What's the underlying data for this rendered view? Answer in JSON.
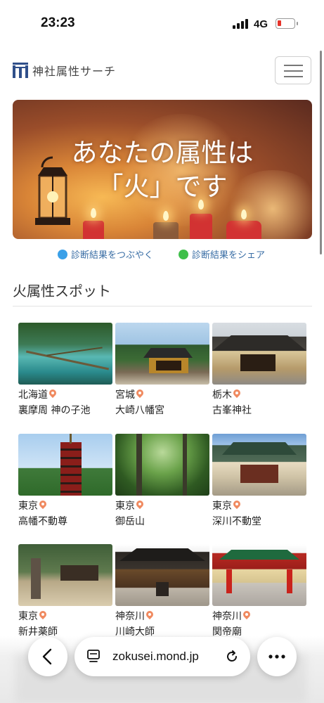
{
  "status_bar": {
    "time": "23:23",
    "network": "4G"
  },
  "header": {
    "site_title": "神社属性サーチ"
  },
  "hero": {
    "line1": "あなたの属性は",
    "line2": "「火」です"
  },
  "share": {
    "twitter_label": "診断結果をつぶやく",
    "line_label": "診断結果をシェア"
  },
  "section": {
    "title": "火属性スポット"
  },
  "spots": [
    {
      "pref": "北海道",
      "name": "裏摩周 神の子池"
    },
    {
      "pref": "宮城",
      "name": "大崎八幡宮"
    },
    {
      "pref": "栃木",
      "name": "古峯神社"
    },
    {
      "pref": "東京",
      "name": "高幡不動尊"
    },
    {
      "pref": "東京",
      "name": "御岳山"
    },
    {
      "pref": "東京",
      "name": "深川不動堂"
    },
    {
      "pref": "東京",
      "name": "新井薬師"
    },
    {
      "pref": "神奈川",
      "name": "川崎大師"
    },
    {
      "pref": "神奈川",
      "name": "関帝廟"
    }
  ],
  "browser": {
    "url": "zokusei.mond.jp"
  },
  "colors": {
    "brand": "#2f4f8a",
    "link": "#3a6ea5",
    "pin": "#f08a60",
    "battery_low": "#e5332a"
  }
}
